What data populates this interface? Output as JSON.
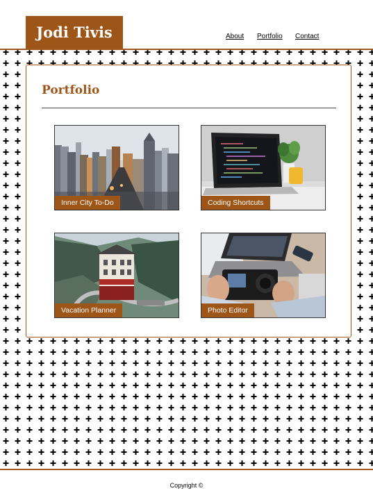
{
  "site": {
    "name": "Jodi Tivis"
  },
  "nav": {
    "about": "About",
    "portfolio": "Portfolio",
    "contact": "Contact"
  },
  "portfolio": {
    "title": "Portfolio",
    "projects": [
      {
        "label": "Inner City To-Do",
        "image": "city-skyline"
      },
      {
        "label": "Coding Shortcuts",
        "image": "laptop-code"
      },
      {
        "label": "Vacation Planner",
        "image": "mountain-hotel"
      },
      {
        "label": "Photo Editor",
        "image": "camera-laptop"
      }
    ]
  },
  "footer": {
    "copyright": "Copyright ©"
  },
  "colors": {
    "accent": "#9e5618",
    "border": "#a0561c"
  }
}
